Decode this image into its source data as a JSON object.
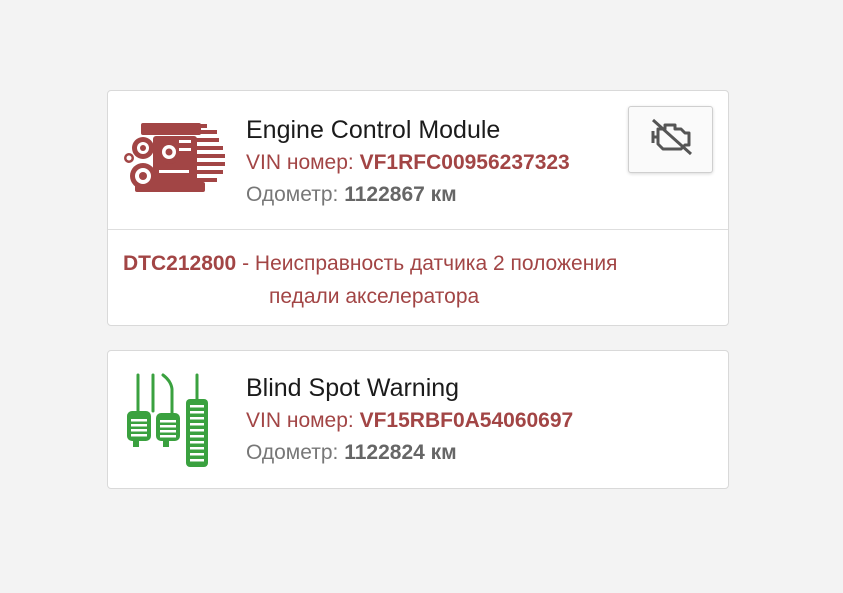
{
  "cards": [
    {
      "title": "Engine Control Module",
      "vin_label": "VIN номер:",
      "vin": "VF1RFC00956237323",
      "odo_label": "Одометр:",
      "odo": "1122867 км",
      "icon": "engine-icon",
      "action_icon": "engine-off-icon",
      "dtc": {
        "code": "DTC212800",
        "separator": " - ",
        "text_line1": "Неисправность датчика 2 положения",
        "text_line2": "педали акселератора"
      }
    },
    {
      "title": "Blind Spot Warning",
      "vin_label": "VIN номер:",
      "vin": "VF15RBF0A54060697",
      "odo_label": "Одометр:",
      "odo": "1122824 км",
      "icon": "pedals-icon"
    }
  ],
  "colors": {
    "accent_red": "#a24545",
    "icon_green": "#3aa13f",
    "text_grey": "#777777",
    "background": "#f3f3f3"
  }
}
